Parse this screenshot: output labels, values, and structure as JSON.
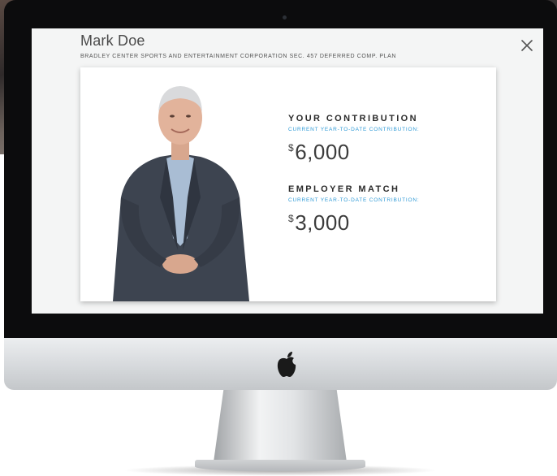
{
  "modal": {
    "user_name": "Mark Doe",
    "plan_name": "BRADLEY CENTER SPORTS AND ENTERTAINMENT CORPORATION SEC. 457 DEFERRED COMP. PLAN",
    "close_icon": "close-icon"
  },
  "contribution": {
    "title": "YOUR CONTRIBUTION",
    "subtitle": "CURRENT YEAR-TO-DATE CONTRIBUTION:",
    "currency": "$",
    "amount": "6,000"
  },
  "employer_match": {
    "title": "EMPLOYER MATCH",
    "subtitle": "CURRENT YEAR-TO-DATE CONTRIBUTION:",
    "currency": "$",
    "amount": "3,000"
  },
  "colors": {
    "accent": "#2f9ad6",
    "bezel": "#0c0c0d",
    "screen_bg": "#f4f5f5"
  },
  "icons": {
    "brand": "apple-logo-icon",
    "close": "close-icon"
  }
}
